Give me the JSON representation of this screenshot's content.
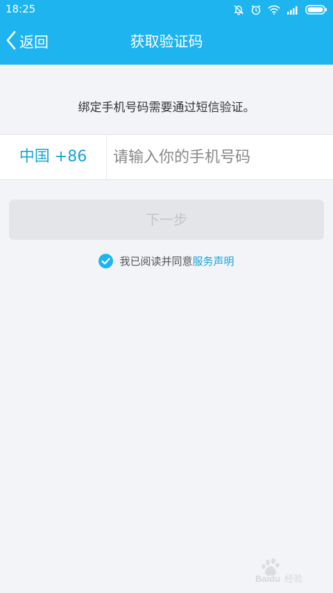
{
  "status_bar": {
    "time": "18:25",
    "icons": [
      "bell-off-icon",
      "alarm-icon",
      "wifi-icon",
      "signal-icon",
      "battery-icon"
    ]
  },
  "header": {
    "back_label": "返回",
    "title": "获取验证码"
  },
  "hint_text": "绑定手机号码需要通过短信验证。",
  "phone": {
    "country_code": "中国 +86",
    "placeholder": "请输入你的手机号码",
    "value": ""
  },
  "next_button_label": "下一步",
  "agreement": {
    "checked": true,
    "text": "我已阅读并同意",
    "link": "服务声明"
  },
  "watermark": "Baidu 经验",
  "colors": {
    "accent": "#1eb4f0",
    "link": "#17a4d6",
    "background": "#f3f4f8"
  }
}
